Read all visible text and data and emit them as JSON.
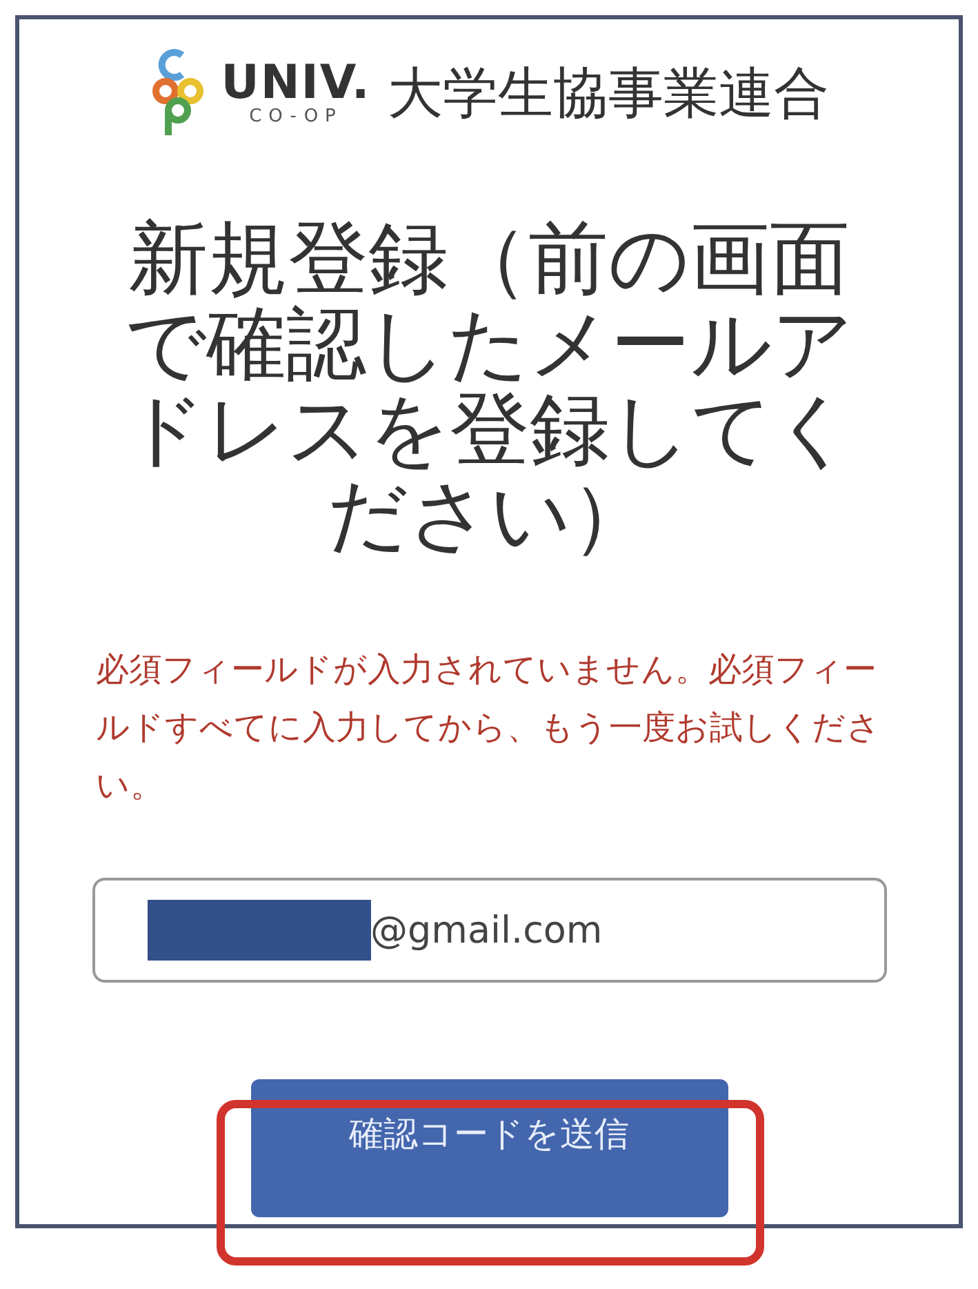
{
  "header": {
    "logo_wordmark": "UNIV.",
    "logo_subtitle": "CO-OP",
    "organization": "大学生協事業連合"
  },
  "title": "新規登録（前の画面で確認したメールアドレスを登録してください）",
  "error_message": "必須フィールドが入力されていません。必須フィールドすべてに入力してから、もう一度お試しください。",
  "email_field": {
    "value": "@gmail.com",
    "redacted": true
  },
  "submit_button": {
    "label": "確認コードを送信",
    "highlighted": true
  }
}
